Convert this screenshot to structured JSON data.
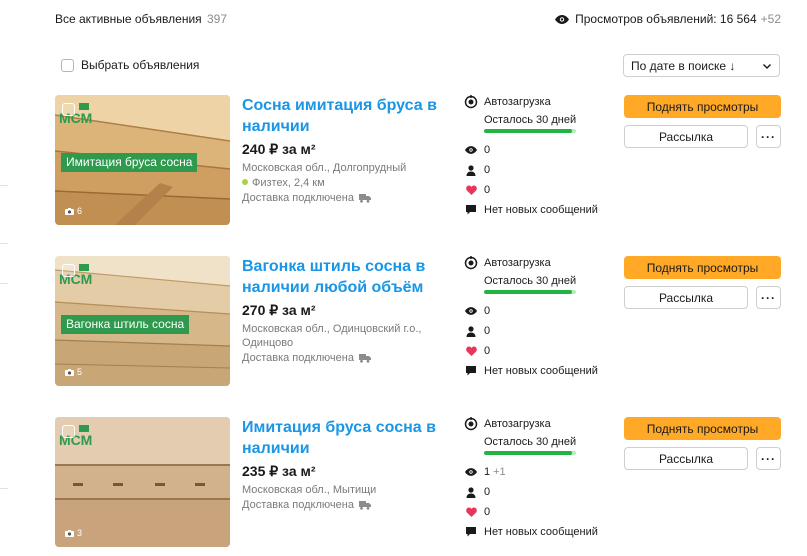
{
  "header": {
    "all_active_label": "Все активные объявления",
    "all_active_count": "397",
    "views_label": "Просмотров объявлений: 16 564",
    "views_plus": "+52"
  },
  "toolbar": {
    "select_label": "Выбрать объявления",
    "sort_value": "По дате в поиске ↓"
  },
  "colors": {
    "accent_blue": "#1a96e6",
    "button_orange": "#ffa927",
    "progress_green": "#22b341",
    "progress_track": "#b6ecbe",
    "metro_green": "#a9d23e",
    "heart_red": "#e8365a"
  },
  "icons": [
    "eye-icon",
    "chevron-down-icon",
    "camera-icon",
    "autoload-icon",
    "user-icon",
    "heart-icon",
    "chat-icon",
    "truck-icon",
    "more-icon"
  ],
  "listings": [
    {
      "title": "Сосна имитация бруса в наличии",
      "price": "240 ₽ за м²",
      "location": "Московская обл., Долгопрудный",
      "metro": "Физтех, 2,4 км",
      "delivery": "Доставка подключена",
      "photo_count": "6",
      "logo_text": "МСМ",
      "banner_text": "Имитация бруса сосна",
      "autoload_label": "Автозагрузка",
      "remaining": "Осталось 30 дней",
      "remaining_progress": 0.96,
      "views": "0",
      "views_plus": "",
      "contacts": "0",
      "favorites": "0",
      "messages": "Нет новых сообщений",
      "raise_button": "Поднять просмотры",
      "mailing_button": "Рассылка",
      "more_button": "···"
    },
    {
      "title": "Вагонка штиль сосна в наличии любой объём",
      "price": "270 ₽ за м²",
      "location": "Московская обл., Одинцовский г.о., Одинцово",
      "metro": "",
      "delivery": "Доставка подключена",
      "photo_count": "5",
      "logo_text": "МСМ",
      "banner_text": "Вагонка штиль сосна",
      "autoload_label": "Автозагрузка",
      "remaining": "Осталось 30 дней",
      "remaining_progress": 0.96,
      "views": "0",
      "views_plus": "",
      "contacts": "0",
      "favorites": "0",
      "messages": "Нет новых сообщений",
      "raise_button": "Поднять просмотры",
      "mailing_button": "Рассылка",
      "more_button": "···"
    },
    {
      "title": "Имитация бруса сосна в наличии",
      "price": "235 ₽ за м²",
      "location": "Московская обл., Мытищи",
      "metro": "",
      "delivery": "Доставка подключена",
      "photo_count": "3",
      "logo_text": "МСМ",
      "banner_text": "",
      "autoload_label": "Автозагрузка",
      "remaining": "Осталось 30 дней",
      "remaining_progress": 0.96,
      "views": "1",
      "views_plus": "+1",
      "contacts": "0",
      "favorites": "0",
      "messages": "Нет новых сообщений",
      "raise_button": "Поднять просмотры",
      "mailing_button": "Рассылка",
      "more_button": "···"
    }
  ]
}
